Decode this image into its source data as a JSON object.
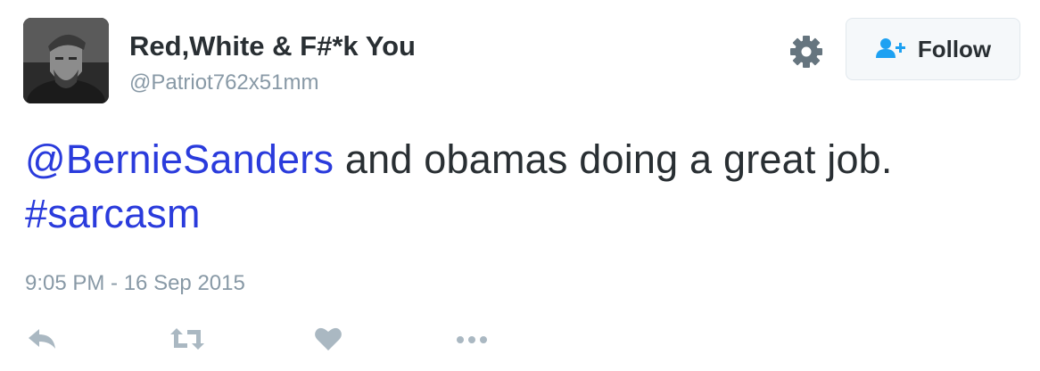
{
  "user": {
    "display_name": "Red,White & F#*k You",
    "handle": "@Patriot762x51mm",
    "avatar_icon": "profile-photo"
  },
  "header": {
    "settings_icon": "gear-icon",
    "follow_icon": "follow-person-icon",
    "follow_label": "Follow"
  },
  "tweet": {
    "mention": "@BernieSanders",
    "text": " and obamas doing a great job. ",
    "hashtag": "#sarcasm",
    "timestamp": "9:05 PM - 16 Sep 2015"
  },
  "actions": [
    {
      "icon": "reply-icon"
    },
    {
      "icon": "retweet-icon"
    },
    {
      "icon": "like-heart-icon"
    },
    {
      "icon": "more-options-icon"
    }
  ],
  "colors": {
    "link": "#2a3bdc",
    "text": "#292f33",
    "muted": "#8899a6",
    "icon": "#aab8c2",
    "follow_accent": "#1da1f2"
  }
}
